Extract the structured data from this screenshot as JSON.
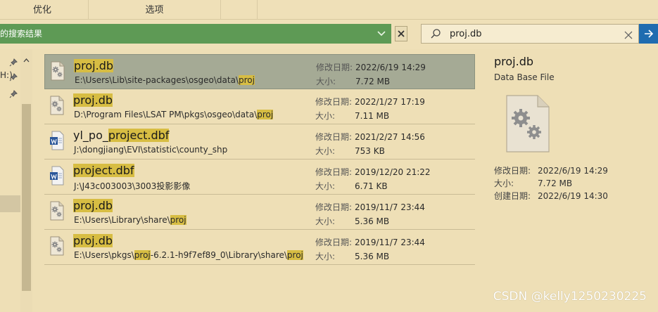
{
  "ribbon": {
    "tabs": [
      {
        "label": "优化"
      },
      {
        "label": "选项"
      }
    ]
  },
  "toolbar": {
    "results_label": "的搜索结果",
    "search_value": "proj.db"
  },
  "nav": {
    "truncated_label": "H:)"
  },
  "results": [
    {
      "name_pre": "",
      "name_hl": "proj.db",
      "name_post": "",
      "path_pre": "E:\\Users\\Lib\\site-packages\\osgeo\\data\\",
      "path_hl": "proj",
      "path_mid": "",
      "path_hl2": "",
      "path_post": "",
      "date_label": "修改日期:",
      "date": "2022/6/19 14:29",
      "size_label": "大小:",
      "size": "7.72 MB",
      "icon": "gear-file-icon"
    },
    {
      "name_pre": "",
      "name_hl": "proj.db",
      "name_post": "",
      "path_pre": "D:\\Program Files\\LSAT PM\\pkgs\\osgeo\\data\\",
      "path_hl": "proj",
      "path_mid": "",
      "path_hl2": "",
      "path_post": "",
      "date_label": "修改日期:",
      "date": "2022/1/27 17:19",
      "size_label": "大小:",
      "size": "7.11 MB",
      "icon": "gear-file-icon"
    },
    {
      "name_pre": "yl_po_",
      "name_hl": "project.dbf",
      "name_post": "",
      "path_pre": "J:\\dongjiang\\EVI\\statistic\\county_shp",
      "path_hl": "",
      "path_mid": "",
      "path_hl2": "",
      "path_post": "",
      "date_label": "修改日期:",
      "date": "2021/2/27 14:56",
      "size_label": "大小:",
      "size": "753 KB",
      "icon": "word-file-icon"
    },
    {
      "name_pre": "",
      "name_hl": "project.dbf",
      "name_post": "",
      "path_pre": "J:\\J43c003003\\3003投影影像",
      "path_hl": "",
      "path_mid": "",
      "path_hl2": "",
      "path_post": "",
      "date_label": "修改日期:",
      "date": "2019/12/20 21:22",
      "size_label": "大小:",
      "size": "6.71 KB",
      "icon": "word-file-icon"
    },
    {
      "name_pre": "",
      "name_hl": "proj.db",
      "name_post": "",
      "path_pre": "E:\\Users\\Library\\share\\",
      "path_hl": "proj",
      "path_mid": "",
      "path_hl2": "",
      "path_post": "",
      "date_label": "修改日期:",
      "date": "2019/11/7 23:44",
      "size_label": "大小:",
      "size": "5.36 MB",
      "icon": "gear-file-icon"
    },
    {
      "name_pre": "",
      "name_hl": "proj.db",
      "name_post": "",
      "path_pre": "E:\\Users\\pkgs\\",
      "path_hl": "proj",
      "path_mid": "-6.2.1-h9f7ef89_0\\Library\\share\\",
      "path_hl2": "proj",
      "path_post": "",
      "date_label": "修改日期:",
      "date": "2019/11/7 23:44",
      "size_label": "大小:",
      "size": "5.36 MB",
      "icon": "gear-file-icon"
    }
  ],
  "details": {
    "title": "proj.db",
    "type": "Data Base File",
    "props": [
      {
        "k": "修改日期:",
        "v": "2022/6/19 14:29"
      },
      {
        "k": "大小:",
        "v": "7.72 MB"
      },
      {
        "k": "创建日期:",
        "v": "2022/6/19 14:30"
      }
    ]
  },
  "watermark": "CSDN @kelly1250230225",
  "colors": {
    "background": "#eedfb6",
    "results_bar": "#5e9a55",
    "highlight": "#d7bd43",
    "selected_row": "#a5aa95",
    "search_go": "#1f6cb0"
  }
}
